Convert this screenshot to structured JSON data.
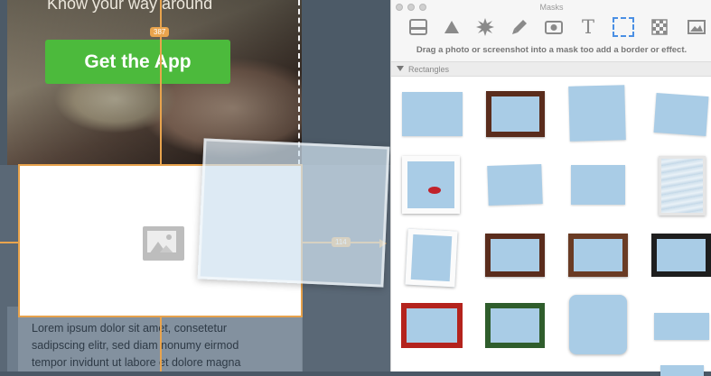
{
  "canvas": {
    "tagline": "Know your way around",
    "cta_label": "Get the App",
    "guide_top_badge": "387",
    "guide_right_badge": "114",
    "lorem_lines": [
      "Lorem ipsum dolor sit amet, consetetur",
      "sadipscing elitr, sed diam nonumy eirmod",
      "tempor invidunt ut labore et dolore magna"
    ]
  },
  "panel": {
    "window_title": "Masks",
    "tools": [
      "panel-icon",
      "triangle-icon",
      "starburst-icon",
      "pen-icon",
      "camera-icon",
      "text-icon",
      "selection-rect-icon",
      "checker-icon",
      "image-icon"
    ],
    "active_tool": "selection-rect-icon",
    "hint": "Drag a photo or screenshot into a mask too add a border or effect.",
    "section_label": "Rectangles",
    "accent_color": "#4a8fe4",
    "guide_color": "#e9a44d",
    "cta_color": "#4cba3c"
  }
}
